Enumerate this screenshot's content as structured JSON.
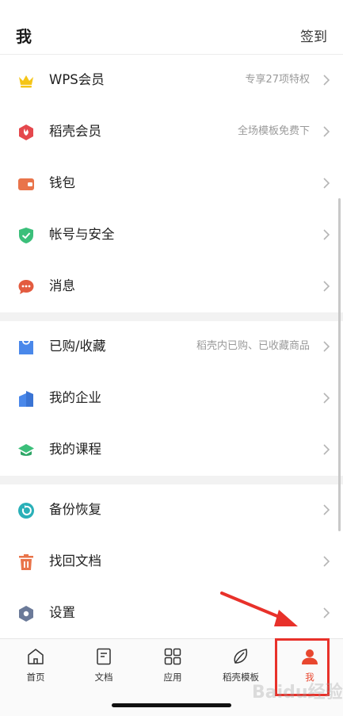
{
  "header": {
    "title": "我",
    "checkin_label": "签到"
  },
  "groups": [
    {
      "items": [
        {
          "label": "WPS会员",
          "hint": "专享27项特权",
          "icon": "crown-icon",
          "color": "#f5c518"
        },
        {
          "label": "稻壳会员",
          "hint": "全场模板免费下",
          "icon": "docer-icon",
          "color": "#e5484d"
        },
        {
          "label": "钱包",
          "hint": "",
          "icon": "wallet-icon",
          "color": "#e9744a"
        },
        {
          "label": "帐号与安全",
          "hint": "",
          "icon": "shield-icon",
          "color": "#3bbf7a"
        },
        {
          "label": "消息",
          "hint": "",
          "icon": "message-icon",
          "color": "#e35b3f"
        }
      ]
    },
    {
      "items": [
        {
          "label": "已购/收藏",
          "hint": "稻壳内已购、已收藏商品",
          "icon": "bag-icon",
          "color": "#4a88ea"
        },
        {
          "label": "我的企业",
          "hint": "",
          "icon": "enterprise-icon",
          "color": "#4a88ea"
        },
        {
          "label": "我的课程",
          "hint": "",
          "icon": "course-icon",
          "color": "#3bbf7a"
        }
      ]
    },
    {
      "items": [
        {
          "label": "备份恢复",
          "hint": "",
          "icon": "backup-icon",
          "color": "#2ab0b8"
        },
        {
          "label": "找回文档",
          "hint": "",
          "icon": "trash-icon",
          "color": "#e9744a"
        },
        {
          "label": "设置",
          "hint": "",
          "icon": "settings-icon",
          "color": "#6b7a99"
        }
      ]
    }
  ],
  "tabbar": {
    "tabs": [
      {
        "label": "首页",
        "icon": "home-icon"
      },
      {
        "label": "文档",
        "icon": "document-icon"
      },
      {
        "label": "应用",
        "icon": "apps-icon"
      },
      {
        "label": "稻壳模板",
        "icon": "leaf-icon"
      },
      {
        "label": "我",
        "icon": "user-icon",
        "active": true
      }
    ]
  },
  "watermark": "Baidu经验",
  "colors": {
    "accent": "#e8472f",
    "annotation": "#e8312a"
  }
}
